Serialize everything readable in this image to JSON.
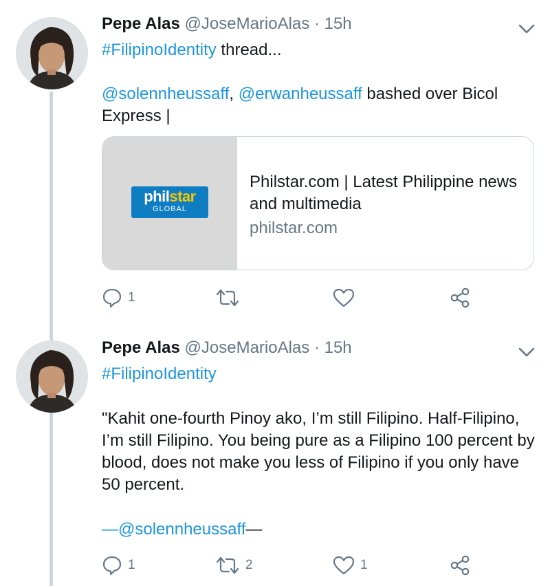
{
  "tweets": [
    {
      "name": "Pepe Alas",
      "handle": "@JoseMarioAlas",
      "sep": " · ",
      "time": "15h",
      "hashtag": "#FilipinoIdentity",
      "hashtag_suffix": " thread...",
      "mention_1": "@solennheussaff",
      "comma": ", ",
      "mention_2": "@erwanheussaff",
      "body_rest": " bashed over Bicol Express |",
      "card": {
        "logo_main_a": "phil",
        "logo_main_b": "star",
        "logo_sub": "GLOBAL",
        "title": "Philstar.com | Latest Philippine news and multimedia",
        "domain": "philstar.com"
      },
      "actions": {
        "reply_count": "1",
        "retweet_count": "",
        "like_count": ""
      }
    },
    {
      "name": "Pepe Alas",
      "handle": "@JoseMarioAlas",
      "sep": " · ",
      "time": "15h",
      "hashtag": "#FilipinoIdentity",
      "quote": "\"Kahit one-fourth Pinoy ako, I’m still Filipino. Half-Filipino, I’m still Filipino. You being pure as a Filipino 100 percent by blood, does not make you less of Filipino if you only have 50 percent.",
      "dash_open": "—",
      "signature": "@solennheussaff",
      "dash_close": "—",
      "actions": {
        "reply_count": "1",
        "retweet_count": "2",
        "like_count": "1"
      }
    }
  ],
  "icons": [
    "avatar",
    "chevron-down-icon",
    "reply-icon",
    "retweet-icon",
    "like-icon",
    "share-icon"
  ],
  "colors": {
    "link": "#1b95e0",
    "muted": "#657786",
    "text": "#14171a",
    "thread_line": "#ccd6dd",
    "philstar_blue": "#0f7dc2",
    "philstar_yellow": "#f7c600"
  }
}
